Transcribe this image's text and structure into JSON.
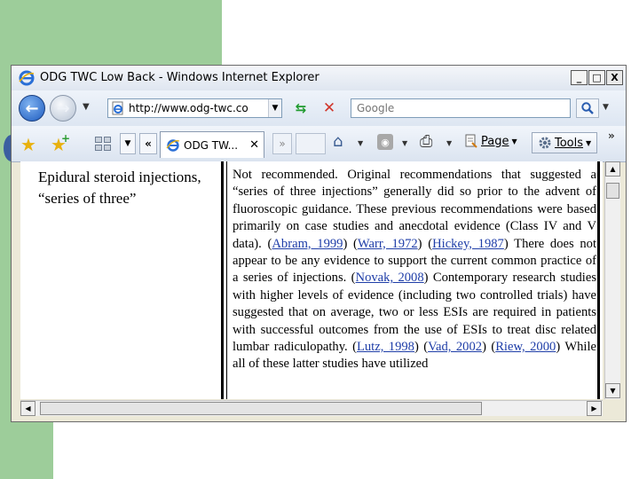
{
  "window": {
    "title": "ODG TWC Low Back - Windows Internet Explorer",
    "minimize": "_",
    "maximize": "□",
    "close": "X"
  },
  "navigation": {
    "address": "http://www.odg-twc.co",
    "search_placeholder": "Google"
  },
  "tabs": {
    "scroll_left": "«",
    "scroll_right": "»",
    "active_label": "ODG TW...",
    "close": "✕"
  },
  "command_bar": {
    "page_label": "Page",
    "tools_label": "Tools",
    "more": "»"
  },
  "content": {
    "topic": "Epidural steroid injections, “series of three”",
    "paragraph": [
      {
        "text": "Not recommended. Original recommendations that suggested a “series of three injections” generally did so prior to the advent of fluoroscopic guidance. These previous recommendations were based primarily on case studies and anecdotal evidence (Class IV and V data). ("
      },
      {
        "link": "Abram, 1999"
      },
      {
        "text": ") ("
      },
      {
        "link": "Warr, 1972"
      },
      {
        "text": ") ("
      },
      {
        "link": "Hickey, 1987"
      },
      {
        "text": ") There does not appear to be any evidence to support the current common practice of a series of injections. ("
      },
      {
        "link": "Novak, 2008"
      },
      {
        "text": ") Contemporary research studies with higher levels of evidence (including two controlled trials) have suggested that on average, two or less ESIs are required in patients with successful outcomes from the use of ESIs to treat disc related lumbar radiculopathy. ("
      },
      {
        "link": "Lutz, 1998"
      },
      {
        "text": ") ("
      },
      {
        "link": "Vad, 2002"
      },
      {
        "text": ") ("
      },
      {
        "link": "Riew, 2000"
      },
      {
        "text": ") While all of these latter studies have utilized"
      }
    ]
  },
  "colors": {
    "slide_green": "#9dcd9a",
    "link": "#1f3ea8",
    "window_chrome": "#ece9d8"
  }
}
